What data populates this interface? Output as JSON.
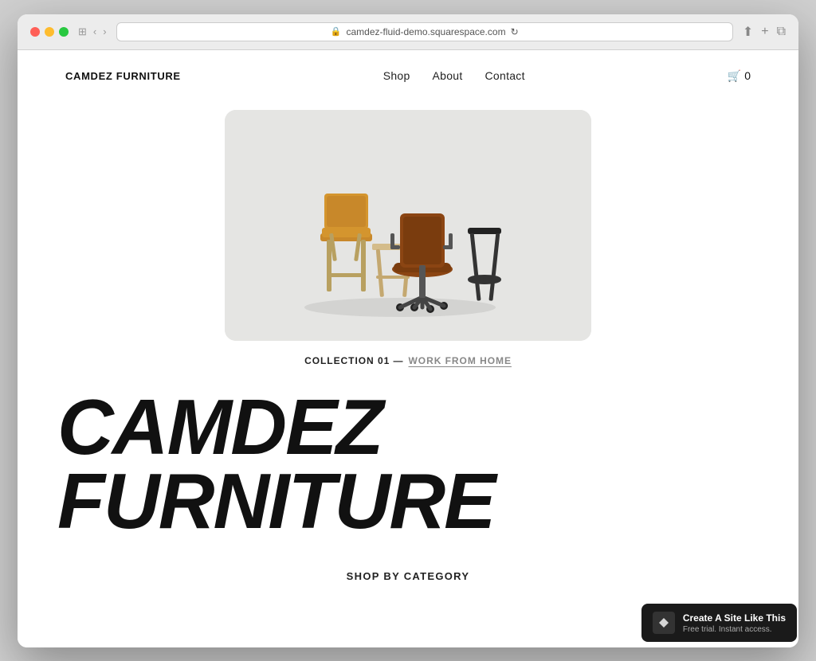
{
  "browser": {
    "url": "camdez-fluid-demo.squarespace.com",
    "refresh_icon": "↻",
    "back_icon": "‹",
    "forward_icon": "›",
    "share_icon": "⬆",
    "add_tab_icon": "+",
    "copy_icon": "⧉"
  },
  "site": {
    "logo": "CAMDEZ FURNITURE",
    "nav": {
      "shop": "Shop",
      "about": "About",
      "contact": "Contact"
    },
    "cart": {
      "icon": "🛒",
      "count": "0"
    },
    "collection": {
      "prefix": "COLLECTION 01 —",
      "link": "WORK FROM HOME"
    },
    "headline": "CAMDEZ FURNITURE",
    "shop_category": "SHOP BY CATEGORY"
  },
  "badge": {
    "title": "Create A Site Like This",
    "subtitle": "Free trial. Instant access.",
    "logo": "⧉"
  }
}
